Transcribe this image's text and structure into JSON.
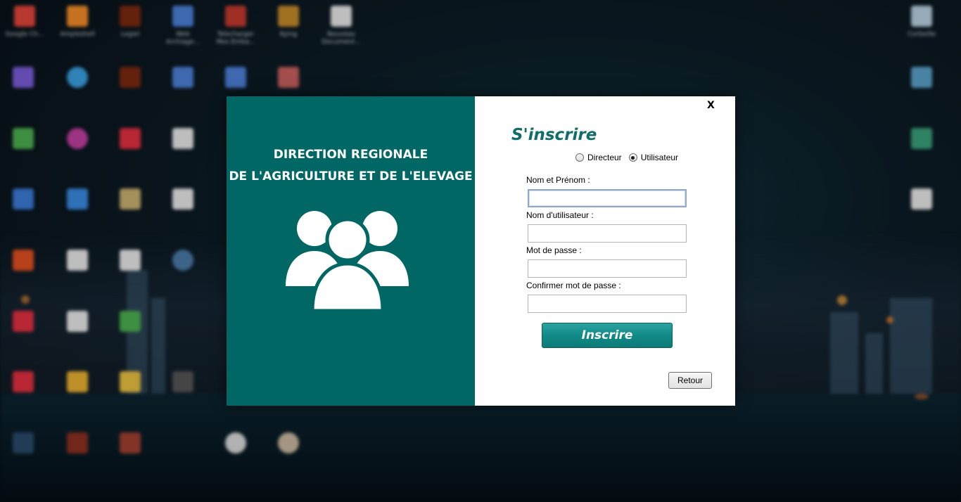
{
  "desktop": {
    "icons": [
      {
        "label": "Google Ch...",
        "color": "#e0453a"
      },
      {
        "label": "Ampleshell",
        "color": "#f28c28"
      },
      {
        "label": "Logiel",
        "color": "#7a2a10"
      },
      {
        "label": "Web Archiage...",
        "color": "#4c7fd6"
      },
      {
        "label": "Telecharger Mes Emba...",
        "color": "#c2392e"
      },
      {
        "label": "Kying",
        "color": "#c58a2a"
      },
      {
        "label": "Nouveau Document...",
        "color": "#e8e8e8"
      },
      {
        "label": "Corbeille",
        "color": "#b8d0e0"
      }
    ]
  },
  "dialog": {
    "brand_color": "#006764",
    "left": {
      "line1": "DIRECTION REGIONALE",
      "line2": "DE L'AGRICULTURE ET DE L'ELEVAGE",
      "icon": "users-group-icon"
    },
    "close_label": "X",
    "title": "S'inscrire",
    "role": {
      "options": [
        "Directeur",
        "Utilisateur"
      ],
      "selected": "Utilisateur"
    },
    "fields": {
      "fullname_label": "Nom et Prénom :",
      "fullname_value": "",
      "username_label": "Nom d'utilisateur :",
      "username_value": "",
      "password_label": "Mot de passe :",
      "password_value": "",
      "confirm_label": "Confirmer mot de passe :",
      "confirm_value": ""
    },
    "submit_label": "Inscrire",
    "back_label": "Retour"
  }
}
